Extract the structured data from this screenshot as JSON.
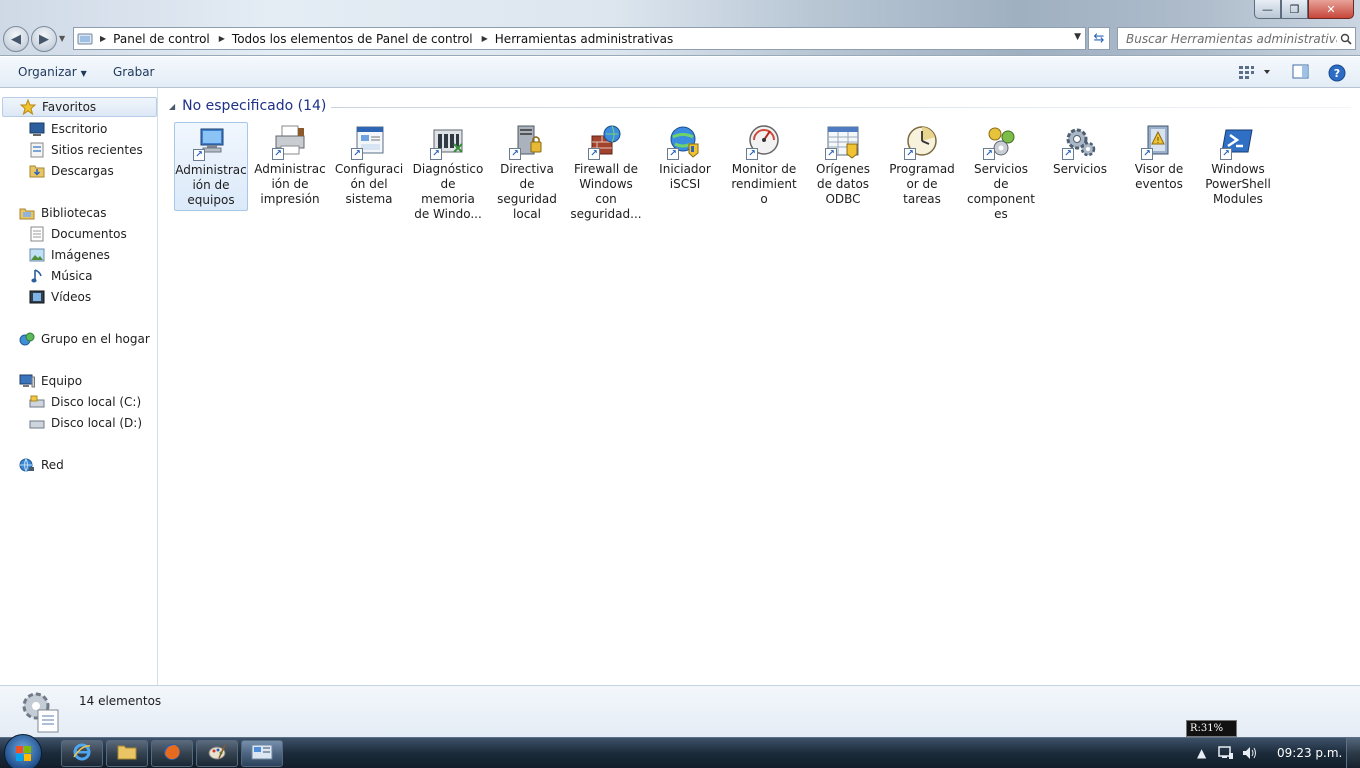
{
  "window": {
    "controls": {
      "minimize": "—",
      "maximize": "❐",
      "close": "✕"
    }
  },
  "address_bar": {
    "crumbs": [
      "Panel de control",
      "Todos los elementos de Panel de control",
      "Herramientas administrativas"
    ]
  },
  "search": {
    "placeholder": "Buscar Herramientas administrativas"
  },
  "toolbar": {
    "organize_label": "Organizar",
    "burn_label": "Grabar"
  },
  "sidebar": {
    "favorites": {
      "label": "Favoritos",
      "items": [
        "Escritorio",
        "Sitios recientes",
        "Descargas"
      ]
    },
    "libraries": {
      "label": "Bibliotecas",
      "items": [
        "Documentos",
        "Imágenes",
        "Música",
        "Vídeos"
      ]
    },
    "homegroup": {
      "label": "Grupo en el hogar"
    },
    "computer": {
      "label": "Equipo",
      "items": [
        "Disco local (C:)",
        "Disco local (D:)"
      ]
    },
    "network": {
      "label": "Red"
    }
  },
  "content": {
    "group_title": "No especificado (14)",
    "items": [
      {
        "label": "Administración de equipos",
        "icon": "computer-management-icon"
      },
      {
        "label": "Administración de impresión",
        "icon": "print-management-icon"
      },
      {
        "label": "Configuración del sistema",
        "icon": "system-configuration-icon"
      },
      {
        "label": "Diagnóstico de memoria de Windo...",
        "icon": "memory-diagnostic-icon"
      },
      {
        "label": "Directiva de seguridad local",
        "icon": "local-security-policy-icon"
      },
      {
        "label": "Firewall de Windows con seguridad...",
        "icon": "firewall-icon"
      },
      {
        "label": "Iniciador iSCSI",
        "icon": "iscsi-initiator-icon"
      },
      {
        "label": "Monitor de rendimiento",
        "icon": "performance-monitor-icon"
      },
      {
        "label": "Orígenes de datos ODBC",
        "icon": "odbc-icon"
      },
      {
        "label": "Programador de tareas",
        "icon": "task-scheduler-icon"
      },
      {
        "label": "Servicios de componentes",
        "icon": "component-services-icon"
      },
      {
        "label": "Servicios",
        "icon": "services-icon"
      },
      {
        "label": "Visor de eventos",
        "icon": "event-viewer-icon"
      },
      {
        "label": "Windows PowerShell Modules",
        "icon": "powershell-icon"
      }
    ]
  },
  "details": {
    "count": "14 elementos"
  },
  "taskbar": {
    "clock": "09:23 p.m.",
    "tooltip": "R:31%"
  }
}
